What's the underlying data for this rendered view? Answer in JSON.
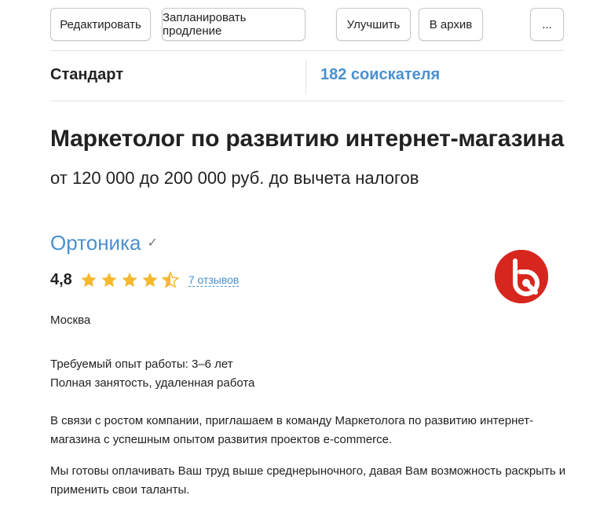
{
  "toolbar": {
    "edit_label": "Редактировать",
    "schedule_label": "Запланировать продление",
    "improve_label": "Улучшить",
    "archive_label": "В архив",
    "more_label": "..."
  },
  "status": {
    "plan": "Стандарт",
    "applicants": "182 соискателя"
  },
  "vacancy": {
    "title": "Маркетолог по развитию интернет-магазина",
    "salary": "от 120 000 до 200 000 руб. до вычета налогов"
  },
  "company": {
    "name": "Ортоника",
    "verified_icon": "check-icon",
    "rating": "4,8",
    "rating_value": 4.8,
    "stars_max": 5,
    "reviews": "7 отзывов",
    "logo_icon": "company-logo",
    "colors": {
      "link": "#4a90d0",
      "star": "#f5b82e",
      "logo": "#d7261e"
    }
  },
  "details": {
    "city": "Москва",
    "experience": "Требуемый опыт работы: 3–6 лет",
    "employment": "Полная занятость, удаленная работа"
  },
  "description": {
    "p1_line1": "В связи с ростом компании, приглашаем в команду Маркетолога по развитию интернет-",
    "p1_line2": "магазина с успешным опытом развития проектов e-commerce.",
    "p2_line1": "Мы готовы оплачивать Ваш труд выше среднерыночного, давая Вам возможность раскрыть и",
    "p2_line2": "применить свои таланты."
  }
}
